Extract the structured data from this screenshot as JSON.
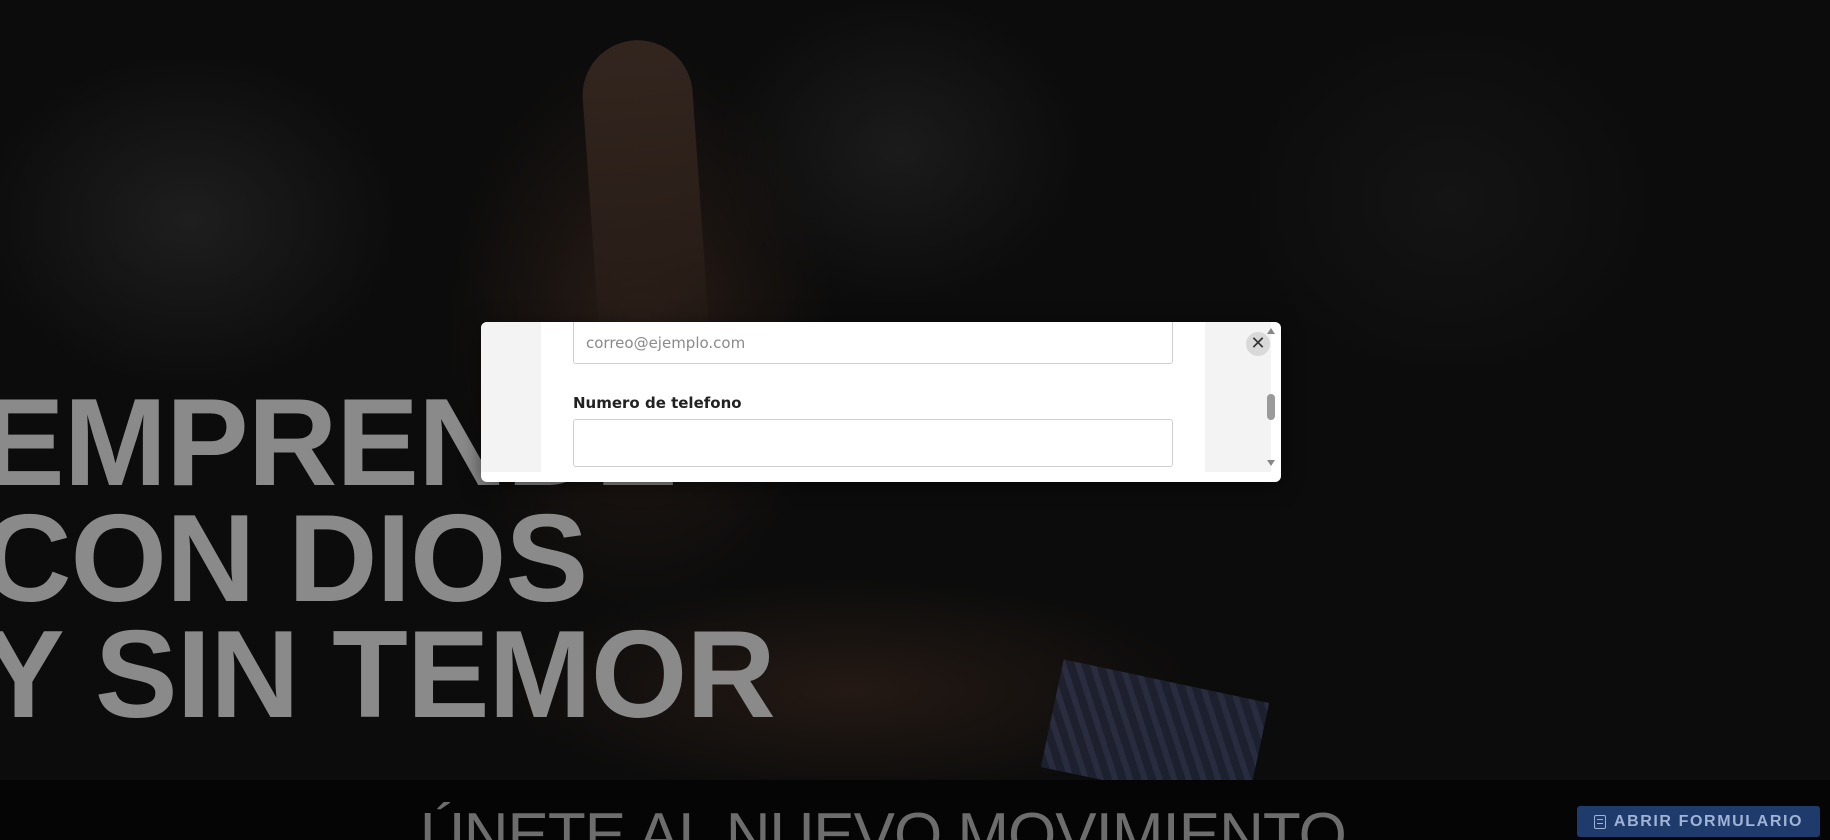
{
  "hero": {
    "title_lines": [
      "EMPRENDE",
      "CON DIOS",
      "Y SIN TEMOR"
    ],
    "subheading": "ÚNETE AL NUEVO MOVIMIENTO"
  },
  "cta": {
    "open_form_label": "ABRIR FORMULARIO",
    "icon": "form-icon",
    "color": "#1f3b6b"
  },
  "modal": {
    "email": {
      "placeholder": "correo@ejemplo.com",
      "value": ""
    },
    "phone": {
      "label": "Numero de telefono",
      "value": ""
    },
    "close_icon": "close-icon",
    "close_glyph": "✕"
  }
}
